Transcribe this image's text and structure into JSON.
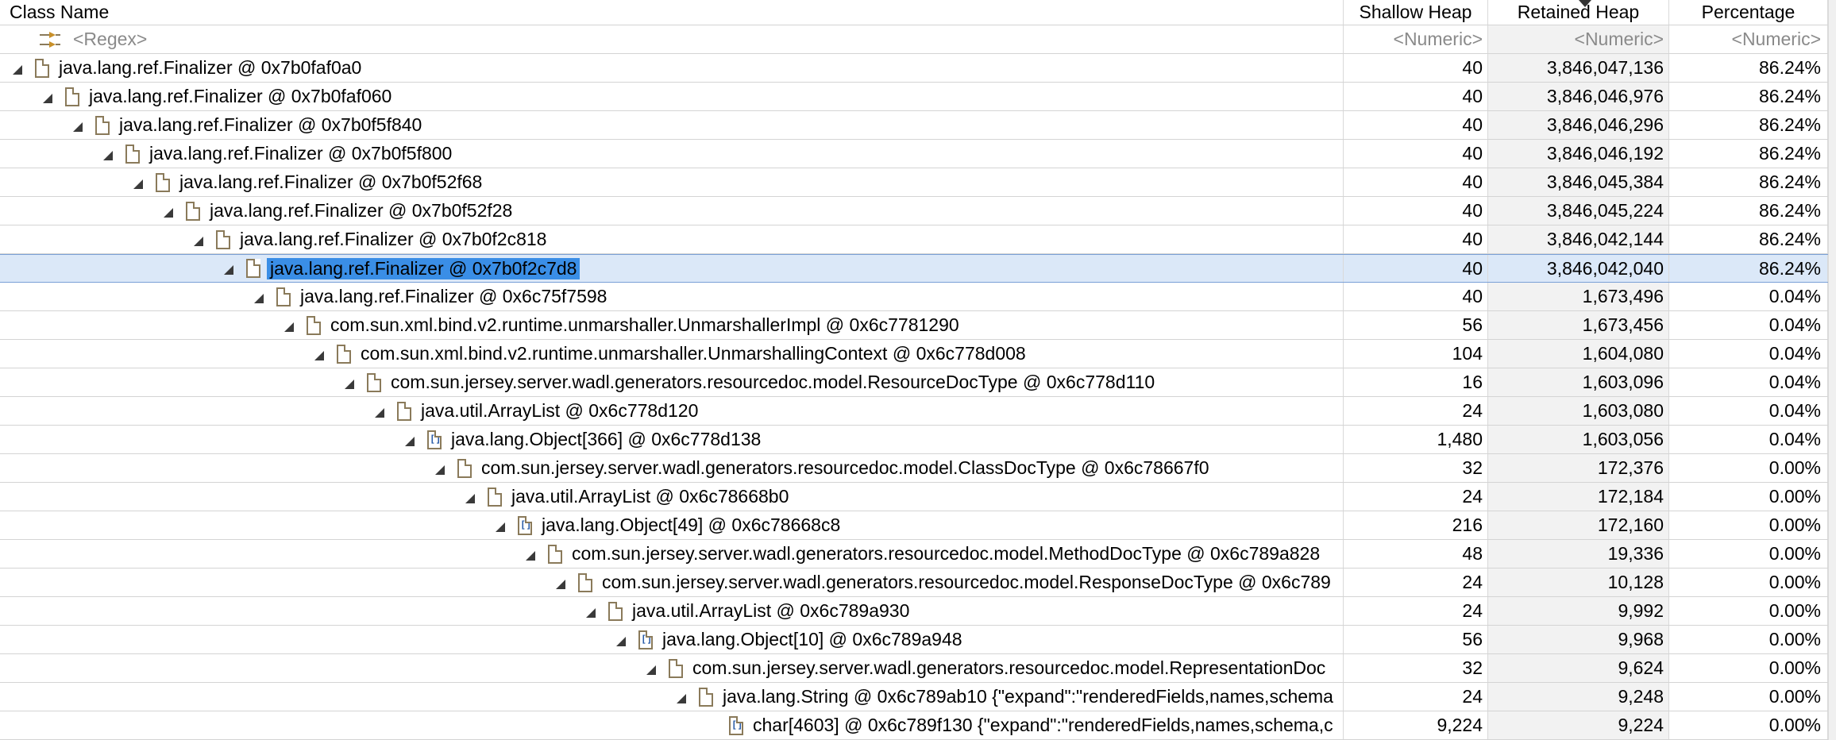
{
  "columns": {
    "name": "Class Name",
    "shallow": "Shallow Heap",
    "retained": "Retained Heap",
    "percentage": "Percentage"
  },
  "filters": {
    "name": "<Regex>",
    "shallow": "<Numeric>",
    "retained": "<Numeric>",
    "percentage": "<Numeric>"
  },
  "rows": [
    {
      "name": "java.lang.ref.Finalizer @ 0x7b0faf0a0",
      "shallow": "40",
      "retained": "3,846,047,136",
      "pct": "86.24%",
      "icon": "object-icon"
    },
    {
      "name": "java.lang.ref.Finalizer @ 0x7b0faf060",
      "shallow": "40",
      "retained": "3,846,046,976",
      "pct": "86.24%",
      "icon": "object-icon"
    },
    {
      "name": "java.lang.ref.Finalizer @ 0x7b0f5f840",
      "shallow": "40",
      "retained": "3,846,046,296",
      "pct": "86.24%",
      "icon": "object-icon"
    },
    {
      "name": "java.lang.ref.Finalizer @ 0x7b0f5f800",
      "shallow": "40",
      "retained": "3,846,046,192",
      "pct": "86.24%",
      "icon": "object-icon"
    },
    {
      "name": "java.lang.ref.Finalizer @ 0x7b0f52f68",
      "shallow": "40",
      "retained": "3,846,045,384",
      "pct": "86.24%",
      "icon": "object-icon"
    },
    {
      "name": "java.lang.ref.Finalizer @ 0x7b0f52f28",
      "shallow": "40",
      "retained": "3,846,045,224",
      "pct": "86.24%",
      "icon": "object-icon"
    },
    {
      "name": "java.lang.ref.Finalizer @ 0x7b0f2c818",
      "shallow": "40",
      "retained": "3,846,042,144",
      "pct": "86.24%",
      "icon": "object-icon"
    },
    {
      "name": "java.lang.ref.Finalizer @ 0x7b0f2c7d8",
      "shallow": "40",
      "retained": "3,846,042,040",
      "pct": "86.24%",
      "icon": "object-icon",
      "selected": true
    },
    {
      "name": "java.lang.ref.Finalizer @ 0x6c75f7598",
      "shallow": "40",
      "retained": "1,673,496",
      "pct": "0.04%",
      "icon": "object-icon"
    },
    {
      "name": "com.sun.xml.bind.v2.runtime.unmarshaller.UnmarshallerImpl @ 0x6c7781290",
      "shallow": "56",
      "retained": "1,673,456",
      "pct": "0.04%",
      "icon": "object-icon"
    },
    {
      "name": "com.sun.xml.bind.v2.runtime.unmarshaller.UnmarshallingContext @ 0x6c778d008",
      "shallow": "104",
      "retained": "1,604,080",
      "pct": "0.04%",
      "icon": "object-icon"
    },
    {
      "name": "com.sun.jersey.server.wadl.generators.resourcedoc.model.ResourceDocType @ 0x6c778d110",
      "shallow": "16",
      "retained": "1,603,096",
      "pct": "0.04%",
      "icon": "object-icon"
    },
    {
      "name": "java.util.ArrayList @ 0x6c778d120",
      "shallow": "24",
      "retained": "1,603,080",
      "pct": "0.04%",
      "icon": "object-icon"
    },
    {
      "name": "java.lang.Object[366] @ 0x6c778d138",
      "shallow": "1,480",
      "retained": "1,603,056",
      "pct": "0.04%",
      "icon": "array-icon"
    },
    {
      "name": "com.sun.jersey.server.wadl.generators.resourcedoc.model.ClassDocType @ 0x6c78667f0",
      "shallow": "32",
      "retained": "172,376",
      "pct": "0.00%",
      "icon": "object-icon"
    },
    {
      "name": "java.util.ArrayList @ 0x6c78668b0",
      "shallow": "24",
      "retained": "172,184",
      "pct": "0.00%",
      "icon": "object-icon"
    },
    {
      "name": "java.lang.Object[49] @ 0x6c78668c8",
      "shallow": "216",
      "retained": "172,160",
      "pct": "0.00%",
      "icon": "array-icon"
    },
    {
      "name": "com.sun.jersey.server.wadl.generators.resourcedoc.model.MethodDocType @ 0x6c789a828",
      "shallow": "48",
      "retained": "19,336",
      "pct": "0.00%",
      "icon": "object-icon"
    },
    {
      "name": "com.sun.jersey.server.wadl.generators.resourcedoc.model.ResponseDocType @ 0x6c789",
      "shallow": "24",
      "retained": "10,128",
      "pct": "0.00%",
      "icon": "object-icon"
    },
    {
      "name": "java.util.ArrayList @ 0x6c789a930",
      "shallow": "24",
      "retained": "9,992",
      "pct": "0.00%",
      "icon": "object-icon"
    },
    {
      "name": "java.lang.Object[10] @ 0x6c789a948",
      "shallow": "56",
      "retained": "9,968",
      "pct": "0.00%",
      "icon": "array-icon"
    },
    {
      "name": "com.sun.jersey.server.wadl.generators.resourcedoc.model.RepresentationDoc",
      "shallow": "32",
      "retained": "9,624",
      "pct": "0.00%",
      "icon": "object-icon"
    },
    {
      "name": "java.lang.String @ 0x6c789ab10 {\"expand\":\"renderedFields,names,schema",
      "shallow": "24",
      "retained": "9,248",
      "pct": "0.00%",
      "icon": "object-icon"
    },
    {
      "name": "char[4603] @ 0x6c789f130 {\"expand\":\"renderedFields,names,schema,c",
      "shallow": "9,224",
      "retained": "9,224",
      "pct": "0.00%",
      "icon": "array-icon",
      "leaf": true
    }
  ]
}
